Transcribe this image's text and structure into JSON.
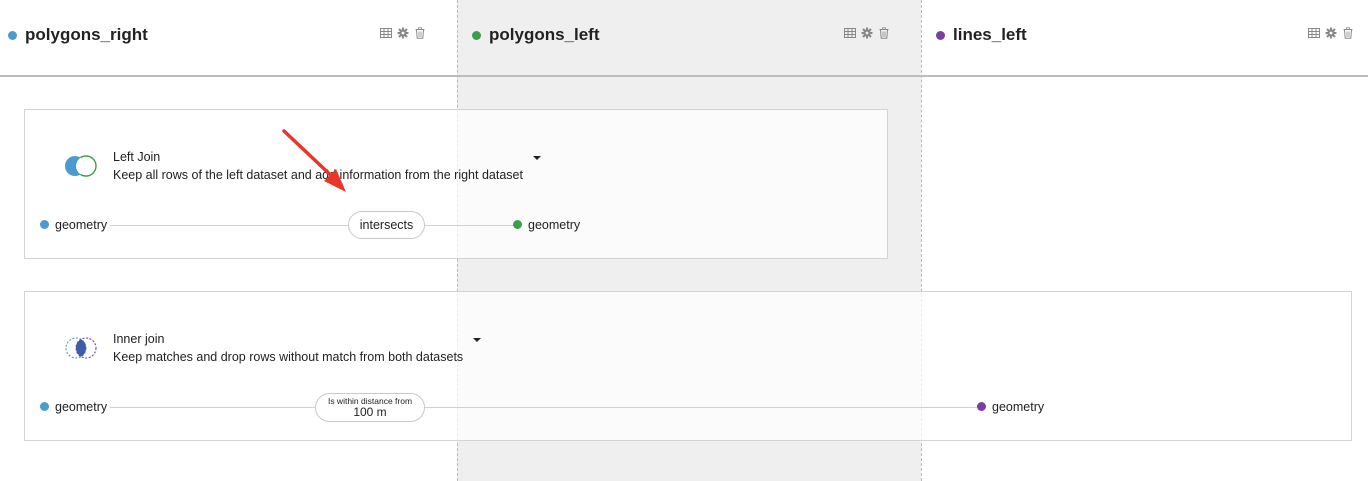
{
  "datasets": [
    {
      "name": "polygons_right",
      "color": "#4a9bd0"
    },
    {
      "name": "polygons_left",
      "color": "#3a9e4a"
    },
    {
      "name": "lines_left",
      "color": "#7b3fa0"
    }
  ],
  "tools": {
    "table_icon": "table-icon",
    "settings_icon": "gear-icon",
    "delete_icon": "trash-icon"
  },
  "joins": [
    {
      "title": "Left Join",
      "description": "Keep all rows of the left dataset and add information from the right dataset",
      "left_column": "geometry",
      "operator": "intersects",
      "right_column": "geometry"
    },
    {
      "title": "Inner join",
      "description": "Keep matches and drop rows without match from both datasets",
      "left_column": "geometry",
      "operator": "Is within distance from",
      "operator_value": "100 m",
      "right_column": "geometry"
    }
  ]
}
